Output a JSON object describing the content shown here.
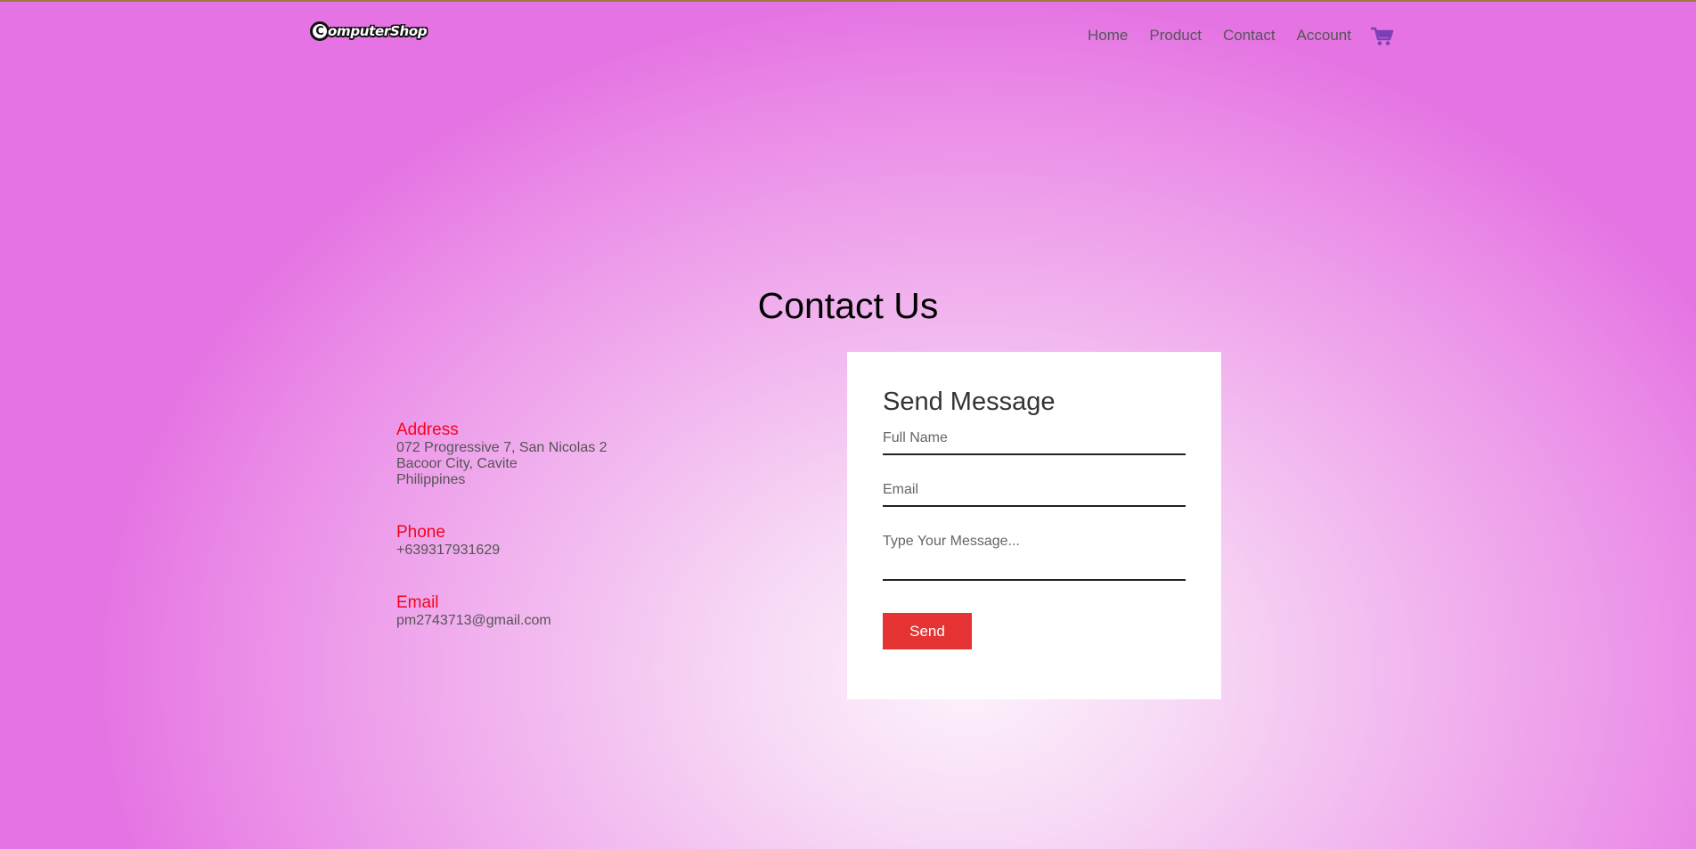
{
  "header": {
    "logo_text": "omputerShop",
    "nav": [
      {
        "label": "Home"
      },
      {
        "label": "Product"
      },
      {
        "label": "Contact"
      },
      {
        "label": "Account"
      }
    ],
    "cart_icon": "shopping-cart-icon"
  },
  "page": {
    "title": "Contact Us"
  },
  "contact_info": {
    "address": {
      "heading": "Address",
      "line1": "072 Progressive 7, San Nicolas 2",
      "line2": "Bacoor City, Cavite",
      "line3": "Philippines"
    },
    "phone": {
      "heading": "Phone",
      "value": "+639317931629"
    },
    "email": {
      "heading": "Email",
      "value": "pm2743713@gmail.com"
    }
  },
  "form": {
    "title": "Send Message",
    "fullname_placeholder": "Full Name",
    "email_placeholder": "Email",
    "message_placeholder": "Type Your Message...",
    "send_label": "Send"
  },
  "colors": {
    "accent_red": "#e53333",
    "heading_red": "#f2051d",
    "cart_purple": "#7b3fb5",
    "background": "#ec9aea"
  }
}
